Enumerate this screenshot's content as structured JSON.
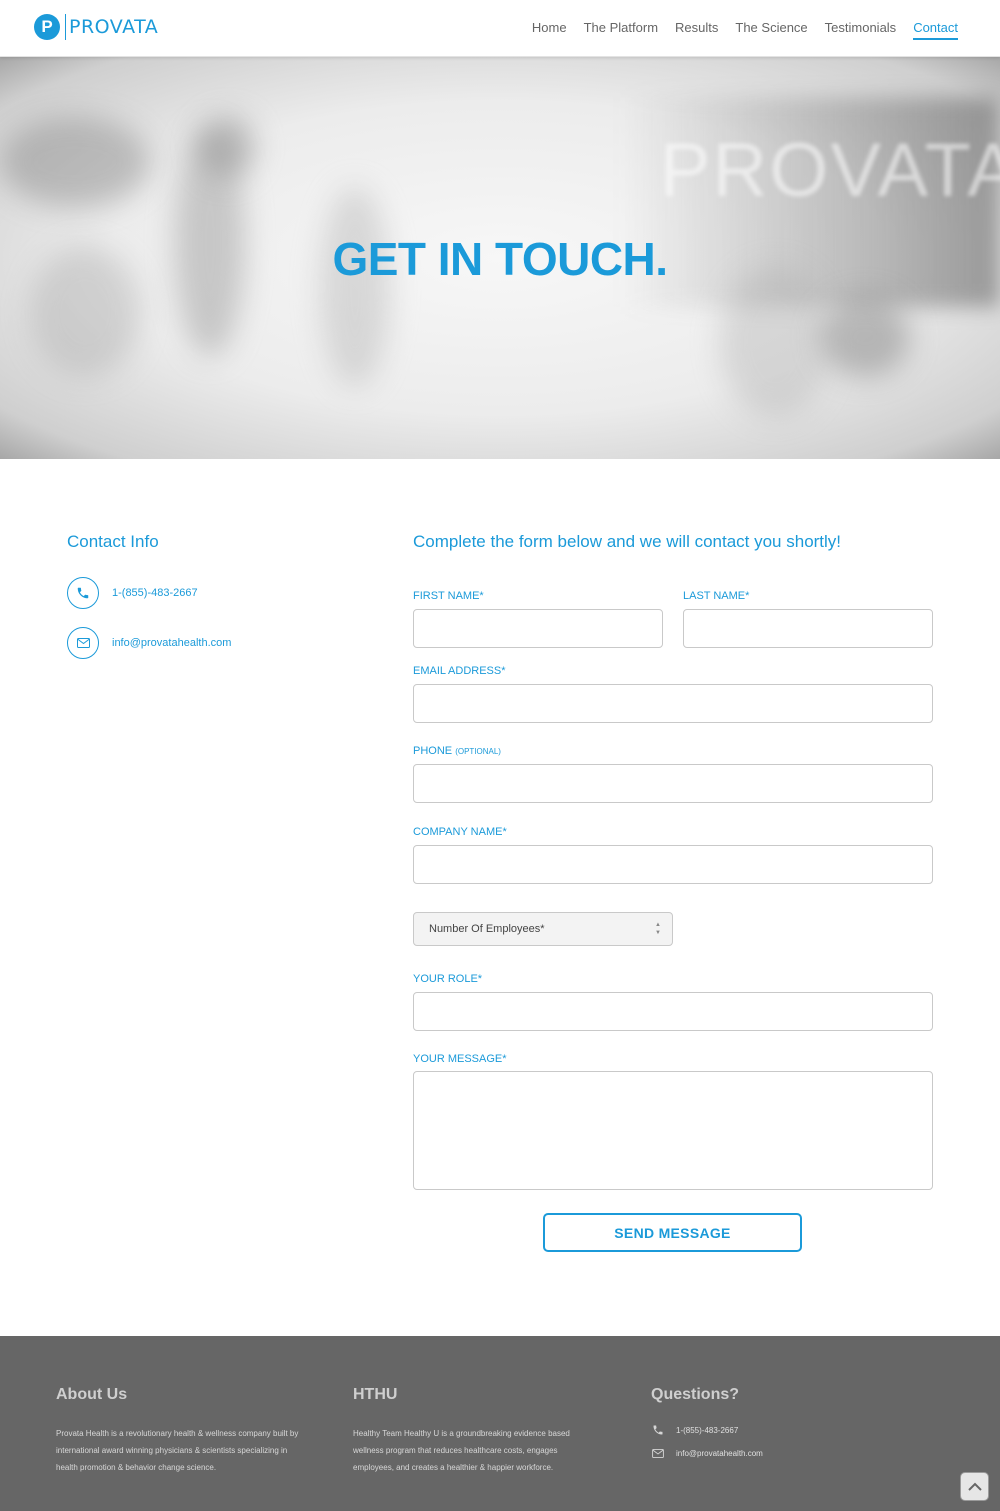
{
  "header": {
    "logo_mark": "P",
    "logo_text": "PROVATA",
    "nav": [
      "Home",
      "The Platform",
      "Results",
      "The Science",
      "Testimonials",
      "Contact"
    ],
    "active_nav": "Contact"
  },
  "hero": {
    "title": "GET IN TOUCH.",
    "background_watermark": "PROVATA"
  },
  "contact_info": {
    "title": "Contact Info",
    "phone": "1-(855)-483-2667",
    "email": "info@provatahealth.com",
    "phone_icon": "phone-icon",
    "email_icon": "envelope-icon"
  },
  "form": {
    "title": "Complete the form below and we will contact you shortly!",
    "first_name_label": "FIRST NAME*",
    "last_name_label": "LAST NAME*",
    "email_label": "EMAIL ADDRESS*",
    "phone_label": "PHONE",
    "phone_optional": "(OPTIONAL)",
    "company_label": "COMPANY NAME*",
    "employees_select": "Number Of Employees*",
    "role_label": "YOUR ROLE*",
    "message_label": "YOUR MESSAGE*",
    "submit_label": "SEND MESSAGE"
  },
  "footer": {
    "about_title": "About Us",
    "about_text": "Provata Health is a revolutionary health & wellness company built by international award winning physicians & scientists specializing in health promotion & behavior change science.",
    "hthu_title": "HTHU",
    "hthu_text": "Healthy Team Healthy U is a groundbreaking evidence based wellness program that reduces healthcare costs, engages employees, and creates a healthier & happier workforce.",
    "questions_title": "Questions?",
    "phone": "1-(855)-483-2667",
    "email": "info@provatahealth.com"
  },
  "colors": {
    "brand_blue": "#1b9ad9",
    "footer_gray": "#666666",
    "field_border": "#c9c9c9"
  }
}
